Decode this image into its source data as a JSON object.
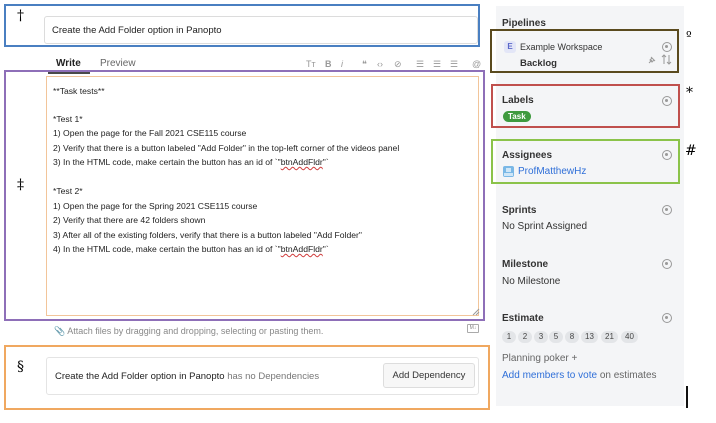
{
  "annotations": {
    "title_mark": "†",
    "description_mark": "‡",
    "dependencies_mark": "§",
    "pipeline_mark": "º",
    "labels_mark": "*",
    "assignees_mark": "#"
  },
  "issue": {
    "title": "Create the Add Folder option in Panopto"
  },
  "editor": {
    "tabs": [
      "Write",
      "Preview"
    ],
    "toolbar": [
      "Tт",
      "B",
      "i",
      "❝",
      "‹›",
      "⊘",
      "☰",
      "☰",
      "☰",
      "@"
    ],
    "description_lines": [
      "**Task tests**",
      "",
      "*Test 1*",
      "1) Open the page for the Fall 2021 CSE115 course",
      "2) Verify that there is a button labeled \"Add Folder\" in the top-left corner of the videos panel",
      "3) In the HTML code, make certain the button has an id of `\"",
      "",
      "*Test 2*",
      "1) Open the page for the Spring 2021 CSE115 course",
      "2) Verify that there are 42 folders shown",
      "3) After all of the existing folders, verify that there is a button labeled \"Add Folder\"",
      "4) In the HTML code, make certain the button has an id of `\""
    ],
    "id_value": "btnAddFldr",
    "id_suffix": "\"`",
    "attach_hint": "Attach files by dragging and dropping, selecting or pasting them.",
    "markdown_badge": "M↓"
  },
  "dependencies": {
    "issue_title": "Create the Add Folder option in Panopto",
    "status_text": "has no Dependencies",
    "add_button": "Add Dependency"
  },
  "sidebar": {
    "pipelines": {
      "title": "Pipelines",
      "workspace_icon": "E",
      "workspace": "Example Workspace",
      "pipeline": "Backlog"
    },
    "labels": {
      "title": "Labels",
      "items": [
        "Task"
      ]
    },
    "assignees": {
      "title": "Assignees",
      "user": "ProfMatthewHz"
    },
    "sprints": {
      "title": "Sprints",
      "value": "No Sprint Assigned"
    },
    "milestone": {
      "title": "Milestone",
      "value": "No Milestone"
    },
    "estimate": {
      "title": "Estimate",
      "options": [
        "1",
        "2",
        "3",
        "5",
        "8",
        "13",
        "21",
        "40"
      ],
      "planning_poker": "Planning poker",
      "planning_poker_add": "+",
      "add_members_link": "Add members to vote",
      "add_members_suffix": "on estimates"
    }
  },
  "colors": {
    "label_task": "#3f9a3f",
    "link": "#2f6fd8",
    "box_title": "#4a7fc1",
    "box_desc": "#8e6fb8",
    "box_deps": "#f0a860",
    "box_pipe": "#5a4a1e",
    "box_labels": "#c0504d",
    "box_assign": "#8bc34a"
  },
  "icons": [
    "gear-icon",
    "pin-icon",
    "sort-icon",
    "paperclip-icon",
    "markdown-icon",
    "avatar-icon",
    "plus-icon"
  ]
}
